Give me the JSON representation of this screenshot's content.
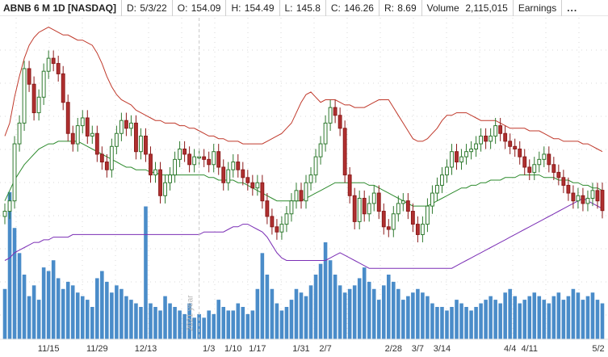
{
  "header": {
    "symbol": "ABNB 6 M 1D [NASDAQ]",
    "date_label": "D:",
    "date_value": "5/3/22",
    "open_label": "O:",
    "open_value": "154.09",
    "high_label": "H:",
    "high_value": "154.49",
    "low_label": "L:",
    "low_value": "145.8",
    "close_label": "C:",
    "close_value": "146.26",
    "range_label": "R:",
    "range_value": "8.69",
    "volume_label": "Volume",
    "volume_value": "2,115,015",
    "earnings_label": "Earnings",
    "more_label": "..."
  },
  "chart_data": {
    "type": "candlestick",
    "year_marker": "2021 year",
    "x_tick_labels": [
      {
        "label": "11/15",
        "index": 9
      },
      {
        "label": "11/29",
        "index": 19
      },
      {
        "label": "12/13",
        "index": 29
      },
      {
        "label": "1/3",
        "index": 42
      },
      {
        "label": "1/10",
        "index": 47
      },
      {
        "label": "1/17",
        "index": 52
      },
      {
        "label": "1/31",
        "index": 61
      },
      {
        "label": "2/7",
        "index": 66
      },
      {
        "label": "2/28",
        "index": 80
      },
      {
        "label": "3/7",
        "index": 85
      },
      {
        "label": "3/14",
        "index": 90
      },
      {
        "label": "4/4",
        "index": 104
      },
      {
        "label": "4/11",
        "index": 108
      },
      {
        "label": "5/2",
        "index": 123
      }
    ],
    "series": [
      {
        "name": "price",
        "close": [
          146.0,
          150.0,
          172.0,
          180.0,
          201.0,
          195.0,
          184.0,
          190.0,
          200.0,
          205.0,
          203.0,
          199.0,
          188.0,
          176.0,
          172.0,
          179.0,
          182.0,
          175.0,
          176.0,
          168.0,
          165.0,
          162.0,
          171.0,
          176.0,
          181.0,
          178.0,
          180.0,
          169.0,
          175.0,
          168.0,
          160.0,
          162.0,
          152.0,
          157.0,
          160.0,
          166.0,
          170.0,
          168.0,
          164.0,
          167.0,
          167.0,
          166.0,
          164.0,
          169.0,
          163.0,
          157.0,
          162.0,
          165.0,
          162.0,
          159.0,
          157.0,
          155.0,
          157.0,
          150.0,
          144.0,
          140.0,
          138.0,
          141.0,
          145.0,
          150.0,
          154.0,
          150.0,
          157.0,
          160.0,
          167.0,
          172.0,
          180.0,
          186.0,
          183.0,
          178.0,
          160.0,
          152.0,
          142.0,
          151.0,
          145.0,
          149.0,
          153.0,
          146.0,
          140.0,
          139.0,
          145.0,
          149.0,
          150.0,
          146.0,
          141.0,
          137.0,
          141.0,
          148.0,
          153.0,
          156.0,
          160.0,
          163.0,
          169.0,
          165.0,
          167.0,
          169.0,
          170.0,
          172.0,
          175.0,
          173.0,
          175.0,
          179.0,
          176.0,
          173.0,
          171.0,
          170.0,
          167.0,
          163.0,
          161.0,
          164.0,
          166.0,
          168.0,
          164.0,
          161.0,
          159.0,
          156.0,
          153.0,
          150.0,
          152.0,
          149.0,
          151.0,
          154.0,
          150.0,
          146.26
        ],
        "open": [
          144.0,
          146.0,
          150.0,
          172.0,
          180.0,
          201.0,
          195.0,
          184.0,
          190.0,
          200.0,
          205.0,
          203.0,
          199.0,
          188.0,
          176.0,
          172.0,
          179.0,
          182.0,
          175.0,
          176.0,
          168.0,
          165.0,
          162.0,
          171.0,
          176.0,
          181.0,
          178.0,
          180.0,
          169.0,
          175.0,
          168.0,
          160.0,
          162.0,
          152.0,
          157.0,
          160.0,
          166.0,
          170.0,
          168.0,
          164.0,
          167.0,
          167.0,
          166.0,
          164.0,
          169.0,
          163.0,
          157.0,
          162.0,
          165.0,
          162.0,
          159.0,
          157.0,
          155.0,
          157.0,
          150.0,
          144.0,
          140.0,
          138.0,
          141.0,
          145.0,
          150.0,
          154.0,
          150.0,
          157.0,
          160.0,
          167.0,
          172.0,
          180.0,
          186.0,
          183.0,
          178.0,
          160.0,
          152.0,
          142.0,
          151.0,
          145.0,
          149.0,
          153.0,
          146.0,
          140.0,
          139.0,
          145.0,
          149.0,
          150.0,
          146.0,
          141.0,
          137.0,
          141.0,
          148.0,
          153.0,
          156.0,
          160.0,
          163.0,
          169.0,
          165.0,
          167.0,
          169.0,
          170.0,
          172.0,
          175.0,
          173.0,
          175.0,
          179.0,
          176.0,
          173.0,
          171.0,
          170.0,
          167.0,
          163.0,
          161.0,
          164.0,
          166.0,
          168.0,
          164.0,
          161.0,
          159.0,
          156.0,
          153.0,
          150.0,
          152.0,
          149.0,
          151.0,
          154.0,
          154.09
        ]
      },
      {
        "name": "upper-band",
        "values": [
          175,
          180,
          190,
          198,
          205,
          210,
          213,
          215,
          216,
          217,
          216,
          215,
          214,
          214,
          213,
          212,
          212,
          211,
          210,
          207,
          203,
          198,
          194,
          191,
          189,
          188,
          187,
          185,
          184,
          183,
          182,
          181,
          181,
          180,
          180,
          180,
          179,
          179,
          178,
          178,
          177,
          176,
          175,
          175,
          174,
          174,
          173,
          173,
          173,
          172,
          172,
          172,
          172,
          172,
          173,
          174,
          175,
          176,
          178,
          180,
          184,
          188,
          191,
          192,
          190,
          188,
          189,
          189,
          189,
          188,
          187,
          187,
          186,
          186,
          186,
          187,
          188,
          189,
          189,
          189,
          186,
          183,
          180,
          177,
          174,
          173,
          173,
          174,
          176,
          178,
          181,
          183,
          183,
          184,
          184,
          184,
          183,
          182,
          181,
          181,
          181,
          181,
          180,
          179,
          178,
          178,
          178,
          178,
          177,
          177,
          177,
          176,
          175,
          174,
          174,
          173,
          173,
          173,
          173,
          172,
          172,
          171,
          170,
          169
        ]
      },
      {
        "name": "middle-band",
        "values": [
          150,
          154,
          158,
          161,
          164,
          166,
          168,
          170,
          171,
          172,
          172,
          173,
          173,
          173,
          173,
          173,
          172,
          171,
          170,
          169,
          168,
          167,
          166,
          165,
          164,
          163,
          163,
          162,
          162,
          162,
          161,
          161,
          160,
          160,
          160,
          160,
          160,
          160,
          160,
          160,
          160,
          160,
          159,
          159,
          158,
          158,
          158,
          158,
          157,
          157,
          156,
          155,
          154,
          153,
          152,
          151,
          150,
          150,
          150,
          150,
          150,
          150,
          151,
          152,
          153,
          154,
          155,
          156,
          157,
          157,
          157,
          157,
          157,
          157,
          157,
          156,
          156,
          155,
          154,
          153,
          152,
          151,
          150,
          149,
          148,
          148,
          148,
          148,
          149,
          150,
          151,
          152,
          153,
          154,
          155,
          155,
          156,
          156,
          157,
          157,
          158,
          158,
          158,
          159,
          159,
          159,
          160,
          160,
          160,
          160,
          160,
          159,
          159,
          159,
          158,
          158,
          158,
          157,
          157,
          156,
          156,
          155,
          155,
          154
        ]
      },
      {
        "name": "lower-band",
        "values": [
          127,
          128,
          130,
          131,
          132,
          133,
          134,
          134,
          135,
          135,
          136,
          136,
          136,
          136,
          137,
          137,
          137,
          137,
          137,
          137,
          137,
          137,
          137,
          137,
          137,
          137,
          137,
          137,
          137,
          137,
          137,
          137,
          137,
          137,
          137,
          137,
          137,
          137,
          137,
          137,
          137,
          138,
          138,
          138,
          138,
          138,
          139,
          140,
          140,
          141,
          141,
          140,
          139,
          138,
          136,
          133,
          130,
          128,
          127,
          127,
          127,
          127,
          127,
          127,
          127,
          127,
          127,
          128,
          129,
          130,
          129,
          128,
          127,
          126,
          125,
          124,
          124,
          124,
          124,
          124,
          124,
          124,
          124,
          124,
          124,
          124,
          124,
          124,
          124,
          124,
          124,
          124,
          124,
          125,
          126,
          127,
          128,
          129,
          130,
          131,
          132,
          133,
          134,
          135,
          136,
          137,
          138,
          139,
          140,
          141,
          142,
          143,
          144,
          145,
          146,
          147,
          148,
          149,
          150,
          151,
          150,
          149,
          148,
          147
        ]
      },
      {
        "name": "volume",
        "values": [
          28,
          82,
          62,
          48,
          36,
          24,
          30,
          22,
          40,
          38,
          44,
          34,
          28,
          32,
          30,
          26,
          24,
          22,
          18,
          34,
          38,
          32,
          26,
          30,
          28,
          24,
          22,
          20,
          18,
          74,
          20,
          18,
          16,
          24,
          20,
          18,
          16,
          14,
          20,
          12,
          14,
          12,
          16,
          14,
          22,
          18,
          16,
          16,
          20,
          18,
          14,
          16,
          28,
          48,
          36,
          28,
          20,
          16,
          18,
          22,
          28,
          26,
          24,
          30,
          36,
          42,
          54,
          44,
          36,
          30,
          26,
          28,
          30,
          34,
          40,
          32,
          28,
          22,
          30,
          36,
          32,
          28,
          22,
          24,
          26,
          28,
          26,
          24,
          20,
          18,
          18,
          16,
          18,
          22,
          20,
          18,
          16,
          18,
          20,
          22,
          24,
          22,
          20,
          26,
          28,
          24,
          20,
          22,
          24,
          26,
          24,
          22,
          20,
          24,
          26,
          22,
          24,
          28,
          26,
          22,
          24,
          26,
          22,
          20
        ]
      }
    ],
    "grid": true
  }
}
